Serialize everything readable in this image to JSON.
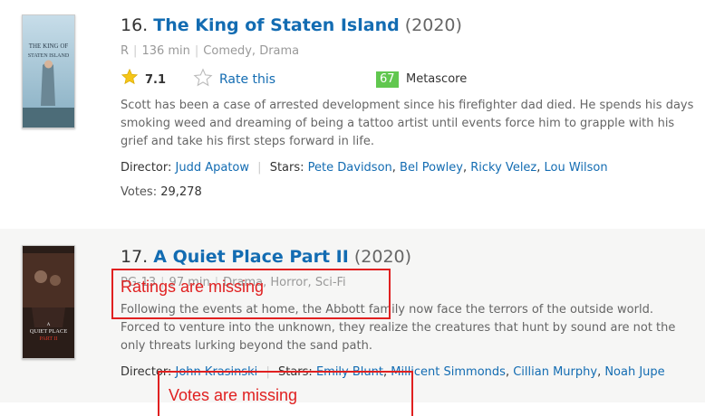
{
  "movies": [
    {
      "index": "16.",
      "title": "The King of Staten Island",
      "year": "(2020)",
      "certificate": "R",
      "runtime": "136 min",
      "genres": "Comedy, Drama",
      "rating": "7.1",
      "rate_label": "Rate this",
      "metascore": "67",
      "metascore_label": "Metascore",
      "description": "Scott has been a case of arrested development since his firefighter dad died. He spends his days smoking weed and dreaming of being a tattoo artist until events force him to grapple with his grief and take his first steps forward in life.",
      "director_label": "Director:",
      "director": "Judd Apatow",
      "stars_label": "Stars:",
      "stars": [
        "Pete Davidson",
        "Bel Powley",
        "Ricky Velez",
        "Lou Wilson"
      ],
      "votes_label": "Votes:",
      "votes": "29,278",
      "poster_text": [
        "THE KING OF",
        "STATEN ISLAND"
      ]
    },
    {
      "index": "17.",
      "title": "A Quiet Place Part II",
      "year": "(2020)",
      "certificate": "PG-13",
      "runtime": "97 min",
      "genres": "Drama, Horror, Sci-Fi",
      "description": "Following the events at home, the Abbott family now face the terrors of the outside world. Forced to venture into the unknown, they realize the creatures that hunt by sound are not the only threats lurking beyond the sand path.",
      "director_label": "Director:",
      "director": "John Krasinski",
      "stars_label": "Stars:",
      "stars": [
        "Emily Blunt",
        "Millicent Simmonds",
        "Cillian Murphy",
        "Noah Jupe"
      ],
      "poster_text": [
        "A",
        "QUIET PLACE",
        "PART II"
      ]
    }
  ],
  "annotations": {
    "ratings_missing": "Ratings are missing",
    "votes_missing": "Votes are missing"
  },
  "colors": {
    "link": "#136cb2",
    "metascore_bg": "#61c74f",
    "annotation": "#e02020",
    "star": "#f5c518"
  }
}
